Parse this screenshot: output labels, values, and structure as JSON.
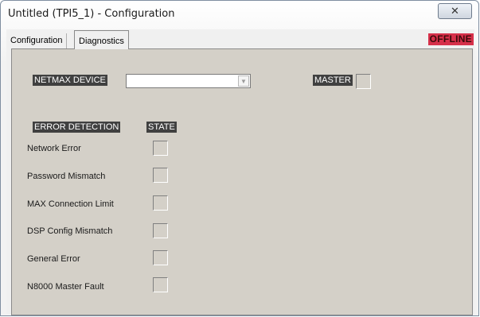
{
  "window": {
    "title": "Untitled (TPI5_1) - Configuration",
    "close_glyph": "✕"
  },
  "tabs": [
    {
      "label": "Configuration",
      "selected": false
    },
    {
      "label": "Diagnostics",
      "selected": true
    }
  ],
  "status": {
    "label": "OFFLINE",
    "color": "#d6304a"
  },
  "device": {
    "label": "NETMAX DEVICE",
    "value": "",
    "dropdown_icon": "chevron-down-icon"
  },
  "master": {
    "label": "MASTER"
  },
  "errors": {
    "header": "ERROR DETECTION",
    "state_header": "STATE",
    "rows": [
      {
        "label": "Network Error"
      },
      {
        "label": "Password Mismatch"
      },
      {
        "label": "MAX Connection Limit"
      },
      {
        "label": "DSP Config Mismatch"
      },
      {
        "label": "General Error"
      },
      {
        "label": "N8000 Master Fault"
      }
    ]
  }
}
